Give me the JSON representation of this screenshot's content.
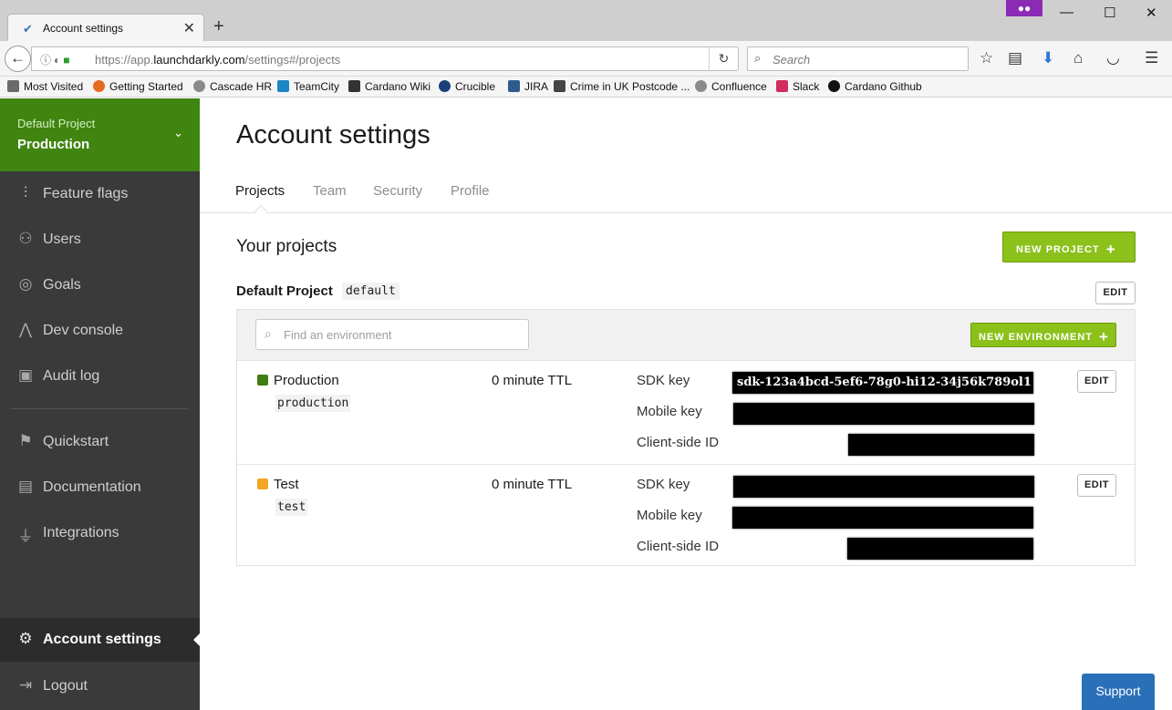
{
  "browser": {
    "tab_title": "Account settings",
    "url_prefix": "https://app.",
    "url_domain": "launchdarkly.com",
    "url_path": "/settings#/projects",
    "search_placeholder": "Search",
    "bookmarks": [
      "Most Visited",
      "Getting Started",
      "Cascade HR",
      "TeamCity",
      "Cardano Wiki",
      "Crucible",
      "JIRA",
      "Crime in UK Postcode ...",
      "Confluence",
      "Slack",
      "Cardano Github"
    ]
  },
  "sidebar": {
    "project": "Default Project",
    "environment": "Production",
    "items": [
      {
        "label": "Feature flags",
        "icon": "sliders-icon"
      },
      {
        "label": "Users",
        "icon": "users-icon"
      },
      {
        "label": "Goals",
        "icon": "target-icon"
      },
      {
        "label": "Dev console",
        "icon": "pulse-icon"
      },
      {
        "label": "Audit log",
        "icon": "log-icon"
      },
      {
        "label": "Quickstart",
        "icon": "signpost-icon"
      },
      {
        "label": "Documentation",
        "icon": "book-icon"
      },
      {
        "label": "Integrations",
        "icon": "plug-icon"
      }
    ],
    "account_settings": "Account settings",
    "logout": "Logout"
  },
  "main": {
    "title": "Account settings",
    "tabs": [
      "Projects",
      "Team",
      "Security",
      "Profile"
    ],
    "active_tab": "Projects",
    "section_title": "Your projects",
    "new_project_label": "NEW PROJECT",
    "project": {
      "name": "Default Project",
      "key": "default",
      "edit_label": "EDIT"
    },
    "env_search_placeholder": "Find an environment",
    "new_environment_label": "NEW ENVIRONMENT",
    "environments": [
      {
        "name": "Production",
        "key": "production",
        "color": "#3f7d12",
        "ttl": "0 minute TTL",
        "sdk_key_label": "SDK key",
        "sdk_key": "sdk-123a4bcd-5ef6-78g0-hi12-34j56k789ol1",
        "mobile_key_label": "Mobile key",
        "client_id_label": "Client-side ID",
        "edit_label": "EDIT"
      },
      {
        "name": "Test",
        "key": "test",
        "color": "#f5a623",
        "ttl": "0 minute TTL",
        "sdk_key_label": "SDK key",
        "sdk_key": "",
        "mobile_key_label": "Mobile key",
        "client_id_label": "Client-side ID",
        "edit_label": "EDIT"
      }
    ]
  },
  "support_label": "Support",
  "colors": {
    "sidebar_bg": "#3a3a3a",
    "project_switcher_bg": "#3f8510",
    "primary_button": "#8bc11a",
    "support_button": "#2a70b8"
  }
}
